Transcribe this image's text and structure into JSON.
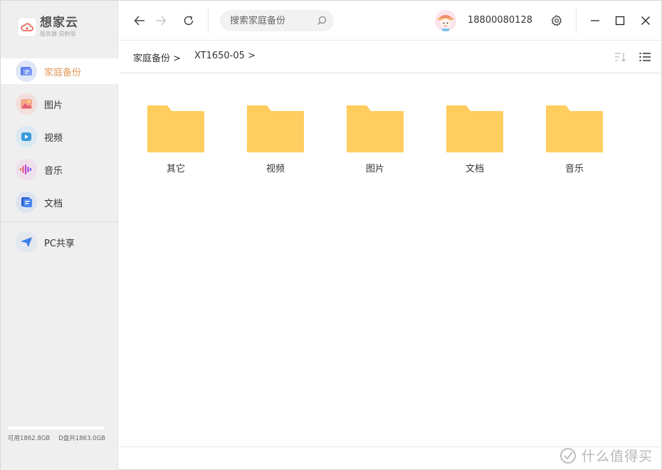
{
  "app": {
    "logo_title": "想家云",
    "logo_subtitle": "服务器·尝鲜版",
    "logo_icon": "cloud-logo-icon"
  },
  "sidebar": {
    "items": [
      {
        "label": "家庭备份",
        "icon": "family-backup-icon",
        "active": true
      },
      {
        "label": "图片",
        "icon": "picture-icon",
        "active": false
      },
      {
        "label": "视频",
        "icon": "video-icon",
        "active": false
      },
      {
        "label": "音乐",
        "icon": "music-icon",
        "active": false
      },
      {
        "label": "文档",
        "icon": "document-icon",
        "active": false
      }
    ],
    "extra_items": [
      {
        "label": "PC共享",
        "icon": "paper-plane-icon"
      }
    ],
    "storage": {
      "available": "可用1862.8GB",
      "total": "D盘共1863.0GB",
      "used_fraction": 0
    }
  },
  "topbar": {
    "search_placeholder": "搜索家庭备份",
    "user_phone": "18800080128"
  },
  "breadcrumb": [
    {
      "label": "家庭备份 >"
    },
    {
      "label": "XT1650-05 >"
    }
  ],
  "folders": [
    {
      "name": "其它"
    },
    {
      "name": "视频"
    },
    {
      "name": "图片"
    },
    {
      "name": "文档"
    },
    {
      "name": "音乐"
    }
  ],
  "watermark": "什么值得买",
  "colors": {
    "accent": "#e39a5e",
    "folder": "#ffcc5e",
    "sidebar_bg": "#efefef"
  }
}
